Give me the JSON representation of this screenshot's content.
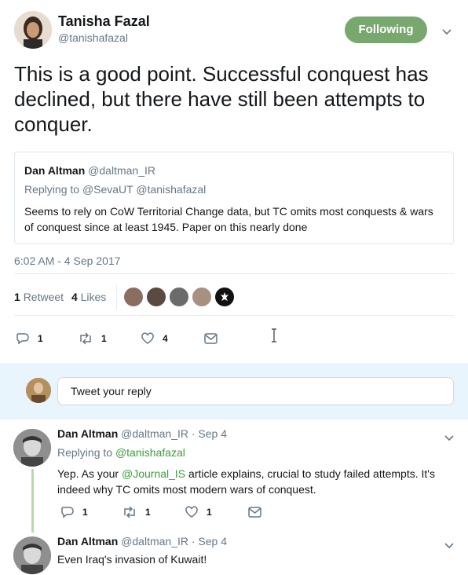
{
  "main": {
    "author_name": "Tanisha Fazal",
    "author_handle": "@tanishafazal",
    "follow_label": "Following",
    "tweet_text": "This is a good point. Successful conquest has declined, but there have still been attempts to conquer.",
    "quote": {
      "name": "Dan Altman",
      "handle": "@daltman_IR",
      "replying_label": "Replying to",
      "replying_to": "@SevaUT @tanishafazal",
      "text": "Seems to rely on CoW Territorial Change data, but TC omits most conquests & wars of conquest since at least 1945. Paper on this nearly done"
    },
    "timestamp": "6:02 AM - 4 Sep 2017",
    "stats": {
      "retweets_count": "1",
      "retweets_label": "Retweet",
      "likes_count": "4",
      "likes_label": "Likes"
    },
    "actions": {
      "reply_count": "1",
      "retweet_count": "1",
      "like_count": "4"
    }
  },
  "reply_box": {
    "placeholder": "Tweet your reply"
  },
  "replies": [
    {
      "name": "Dan Altman",
      "handle": "@daltman_IR",
      "date": "· Sep 4",
      "replying_label": "Replying to",
      "replying_to": "@tanishafazal",
      "text_before": "Yep. As your ",
      "mention": "@Journal_IS",
      "text_after": " article explains, crucial to study failed attempts. It's indeed why TC omits most modern wars of conquest.",
      "reply_count": "1",
      "retweet_count": "1",
      "like_count": "1"
    },
    {
      "name": "Dan Altman",
      "handle": "@daltman_IR",
      "date": "· Sep 4",
      "text": "Even Iraq's invasion of Kuwait!"
    }
  ],
  "colors": {
    "follow_button": "#79a86f",
    "link": "#1da1f2",
    "mention": "#3b9e3a"
  },
  "icons": [
    "reply-icon",
    "retweet-icon",
    "like-icon",
    "dm-icon",
    "chevron-down-icon",
    "rebel-icon"
  ]
}
